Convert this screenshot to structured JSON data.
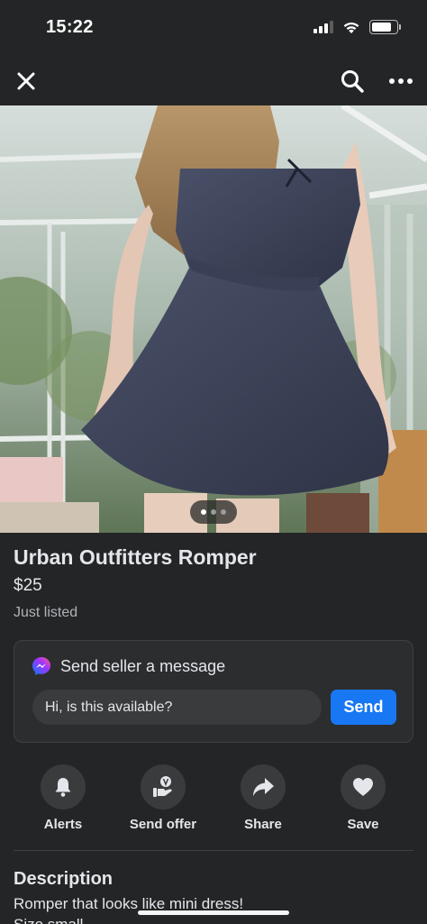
{
  "status_bar": {
    "time": "15:22"
  },
  "nav": {
    "close_icon": "close-icon",
    "search_icon": "search-icon",
    "more_icon": "more-options-icon"
  },
  "photo": {
    "description_icon": "product-photo",
    "current_index": 1,
    "total": 3
  },
  "listing": {
    "title": "Urban Outfitters Romper",
    "price": "$25",
    "listed": "Just listed"
  },
  "message": {
    "title": "Send seller a message",
    "input_value": "Hi, is this available?",
    "send_label": "Send",
    "accent": "#1877f2"
  },
  "actions": [
    {
      "label": "Alerts",
      "icon": "bell-icon"
    },
    {
      "label": "Send offer",
      "icon": "offer-icon"
    },
    {
      "label": "Share",
      "icon": "share-icon"
    },
    {
      "label": "Save",
      "icon": "heart-icon"
    }
  ],
  "description": {
    "heading": "Description",
    "line1": "Romper that looks like mini dress!",
    "line2": "Size small"
  }
}
